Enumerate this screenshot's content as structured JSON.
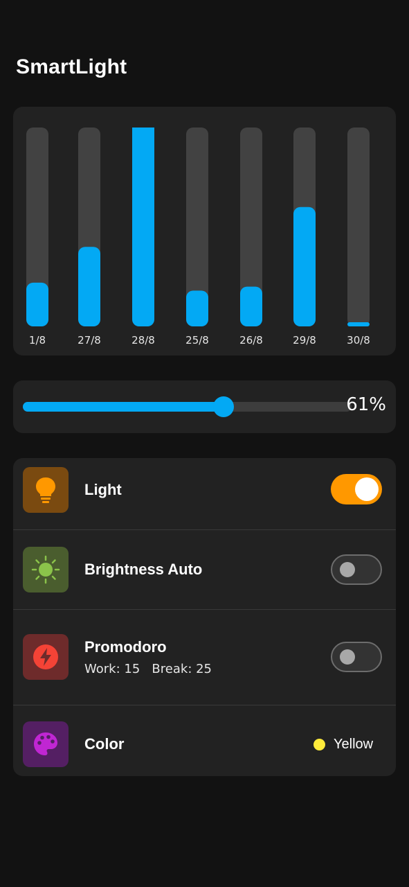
{
  "app": {
    "title": "SmartLight"
  },
  "chart_data": {
    "type": "bar",
    "categories": [
      "1/8",
      "27/8",
      "28/8",
      "25/8",
      "26/8",
      "29/8",
      "30/8"
    ],
    "values": [
      22,
      40,
      100,
      18,
      20,
      60,
      2
    ],
    "ylim": [
      0,
      100
    ],
    "colors": {
      "fill": "#03a9f4",
      "track": "#424242"
    }
  },
  "brightness": {
    "value": 61,
    "display": "61%"
  },
  "settings": {
    "light": {
      "label": "Light",
      "icon": "lightbulb-icon",
      "on": true
    },
    "auto": {
      "label": "Brightness Auto",
      "icon": "sun-icon",
      "on": false
    },
    "promodoro": {
      "label": "Promodoro",
      "subtitle": "Work: 15   Break: 25",
      "icon": "lightning-icon",
      "on": false
    },
    "color": {
      "label": "Color",
      "icon": "palette-icon",
      "value": "Yellow",
      "swatch": "#ffeb3b"
    }
  },
  "colors": {
    "accent": "#03a9f4",
    "toggle_on": "#ff9800",
    "light_tile": "#7a4a10",
    "auto_tile": "#4a5d2e",
    "promodoro_tile": "#6e2b2b",
    "color_tile": "#541f63"
  }
}
